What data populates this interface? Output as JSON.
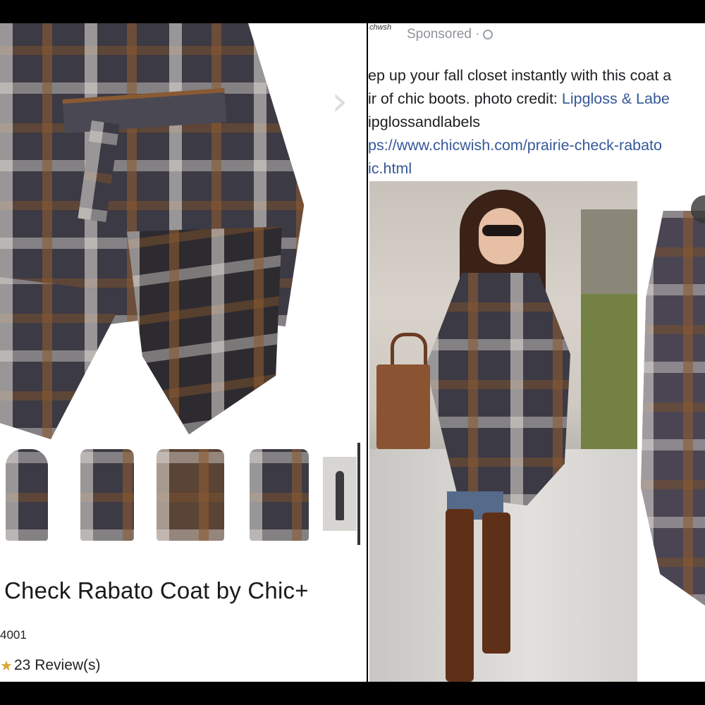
{
  "left_panel": {
    "next_icon": "chevron-right-icon",
    "product": {
      "title": "Check Rabato Coat by Chic+",
      "sku": "4001",
      "star_icon": "star-icon",
      "reviews": "23 Review(s)"
    },
    "thumbnail_count": 5
  },
  "right_panel": {
    "brand_fragment": "chwsh",
    "sponsored_label": "Sponsored ·",
    "privacy_icon": "globe-icon",
    "post_lines": [
      {
        "text": "ep up your fall closet instantly with this coat a"
      },
      {
        "text": "ir of chic boots. photo credit: ",
        "link": "Lipgloss & Labe"
      },
      {
        "text": "ipglossandlabels"
      },
      {
        "link": "ps://www.chicwish.com/prairie-check-rabato"
      },
      {
        "link": "ic.html"
      }
    ]
  },
  "colors": {
    "link": "#365899",
    "meta_gray": "#8f9399",
    "plaid_brown": "#8a5a33",
    "plaid_charcoal": "#3c3a44"
  }
}
